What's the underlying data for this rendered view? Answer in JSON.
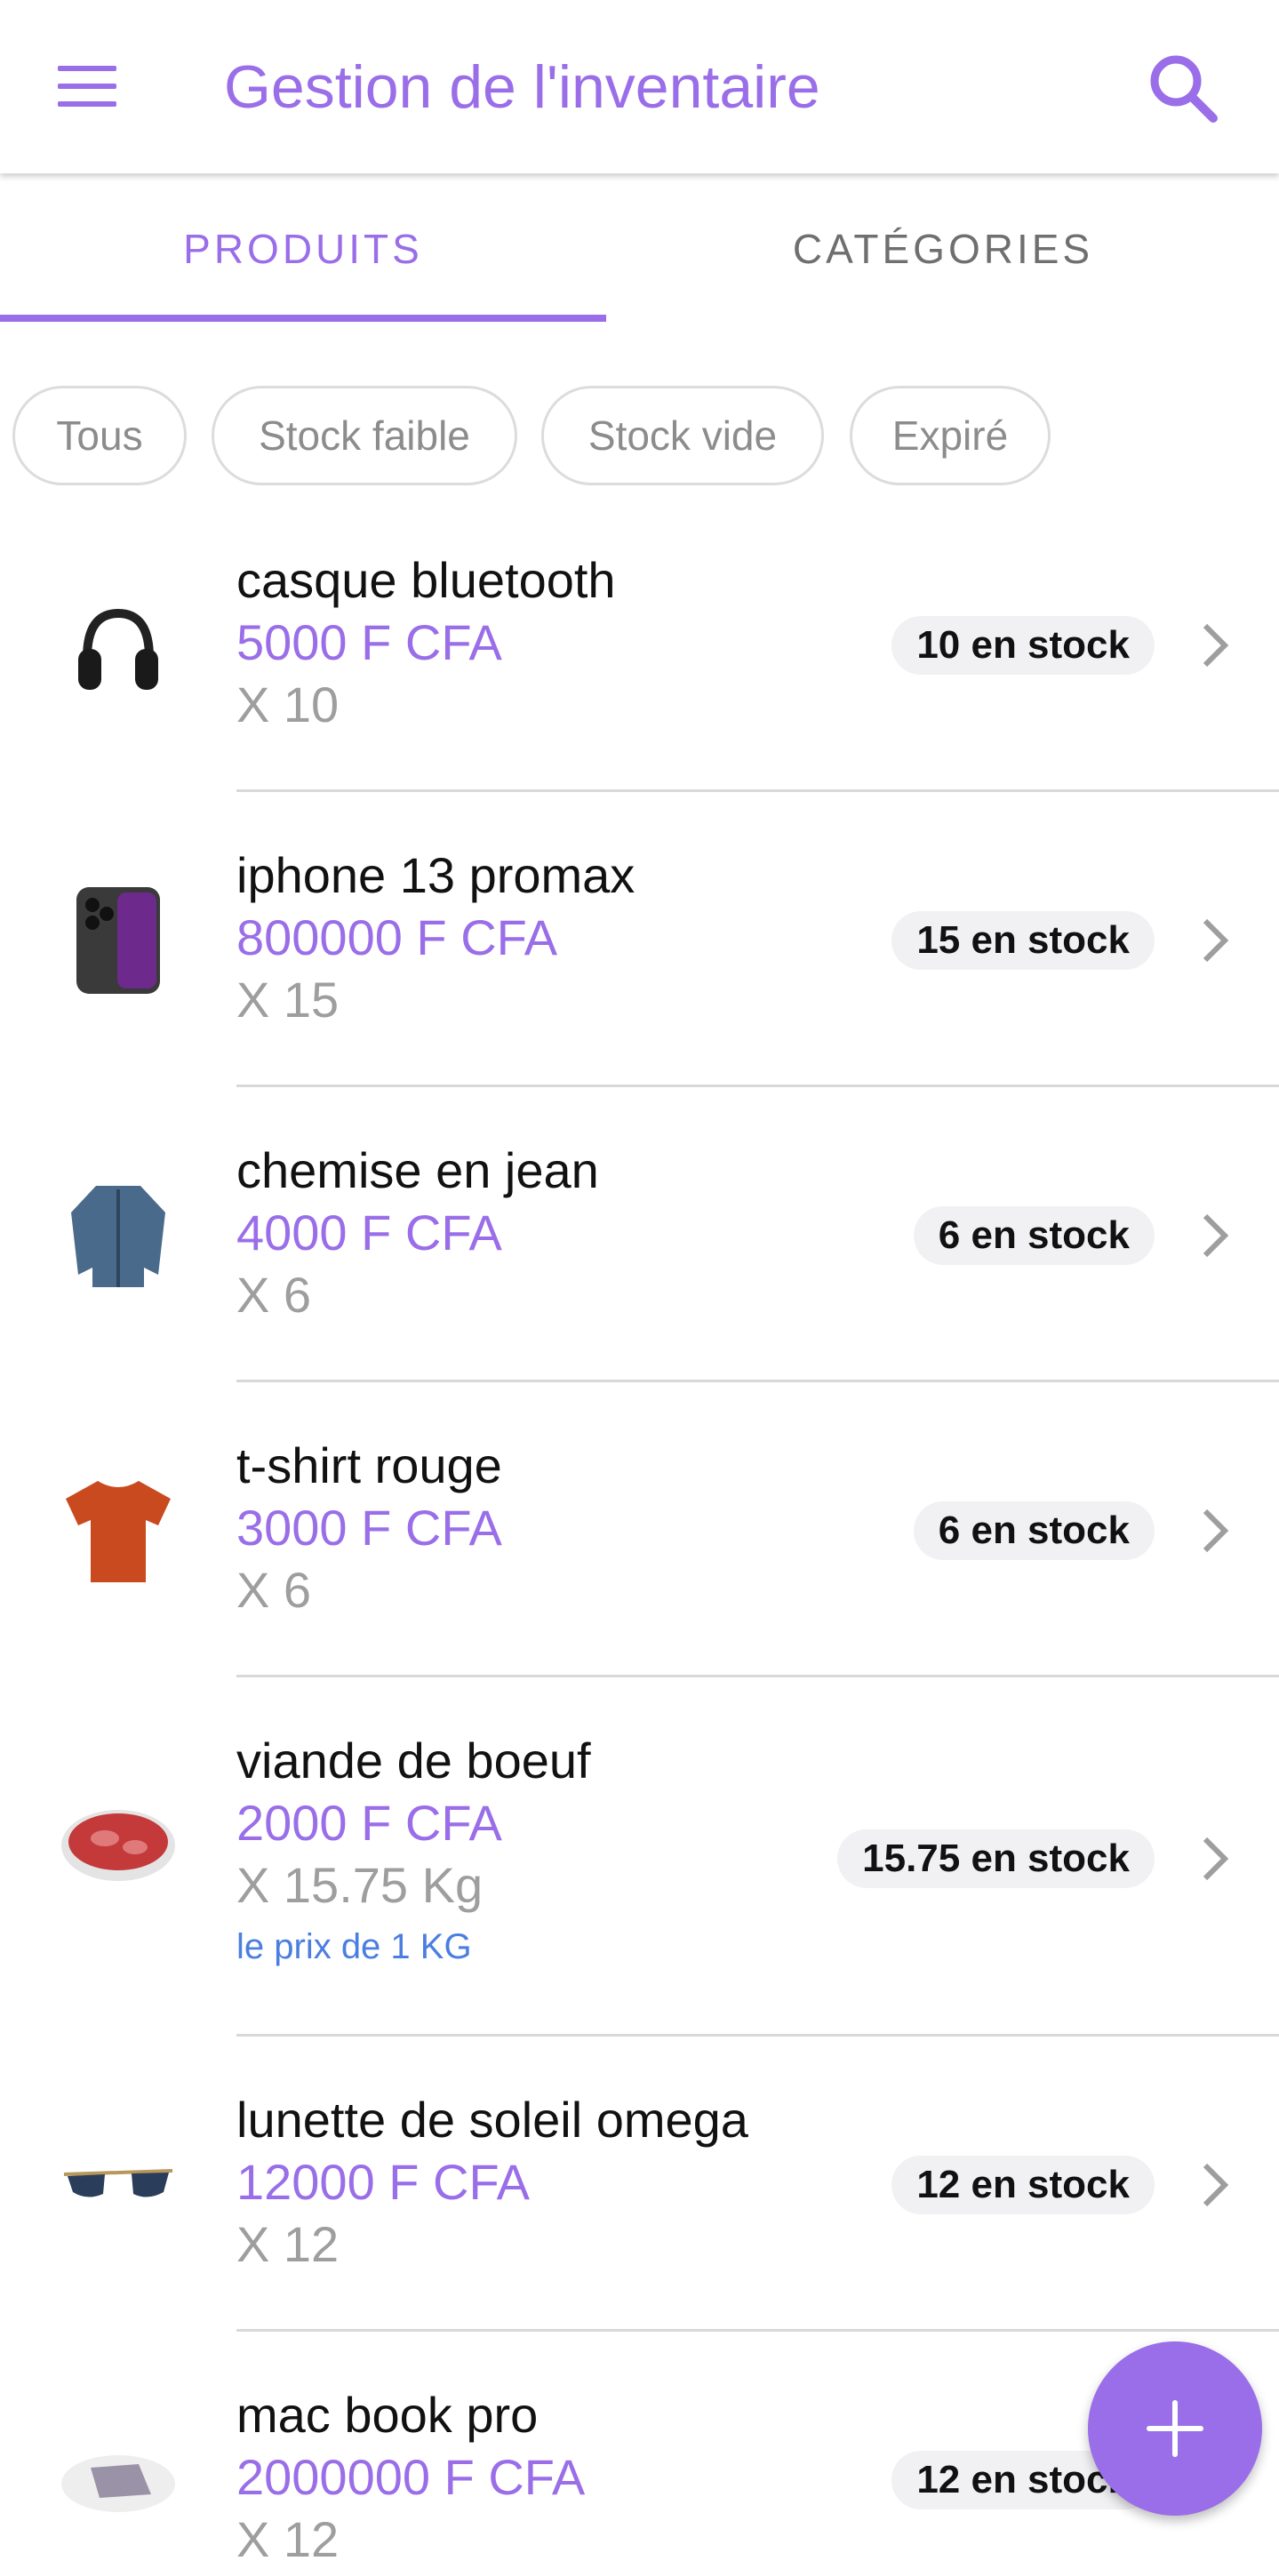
{
  "colors": {
    "accent": "#9a6ee8",
    "note": "#4a7ee0",
    "badge_bg": "#f1f1f3"
  },
  "appbar": {
    "title": "Gestion de l'inventaire",
    "menu_icon": "menu-icon",
    "search_icon": "search-icon"
  },
  "tabs": [
    {
      "label": "PRODUITS",
      "selected": true
    },
    {
      "label": "CATÉGORIES",
      "selected": false
    }
  ],
  "filters": [
    "Tous",
    "Stock faible",
    "Stock vide",
    "Expiré"
  ],
  "products": [
    {
      "name": "casque bluetooth",
      "price": "5000 F CFA",
      "qty": "X 10",
      "stock": "10 en stock",
      "note": "",
      "icon": "headphones-icon"
    },
    {
      "name": "iphone 13 promax",
      "price": "800000 F CFA",
      "qty": "X 15",
      "stock": "15 en stock",
      "note": "",
      "icon": "phone-icon"
    },
    {
      "name": "chemise en jean",
      "price": "4000 F CFA",
      "qty": "X 6",
      "stock": "6 en stock",
      "note": "",
      "icon": "jacket-icon"
    },
    {
      "name": "t-shirt rouge",
      "price": "3000 F CFA",
      "qty": "X 6",
      "stock": "6 en stock",
      "note": "",
      "icon": "tshirt-icon"
    },
    {
      "name": "viande de boeuf",
      "price": "2000 F CFA",
      "qty": "X 15.75 Kg",
      "stock": "15.75 en stock",
      "note": "le prix de 1 KG",
      "icon": "meat-icon"
    },
    {
      "name": "lunette de soleil omega",
      "price": "12000 F CFA",
      "qty": "X 12",
      "stock": "12 en stock",
      "note": "",
      "icon": "sunglasses-icon"
    },
    {
      "name": "mac book pro",
      "price": "2000000 F CFA",
      "qty": "X 12",
      "stock": "12 en stock",
      "note": "",
      "icon": "laptop-icon"
    }
  ],
  "fab": {
    "icon": "plus-icon"
  }
}
